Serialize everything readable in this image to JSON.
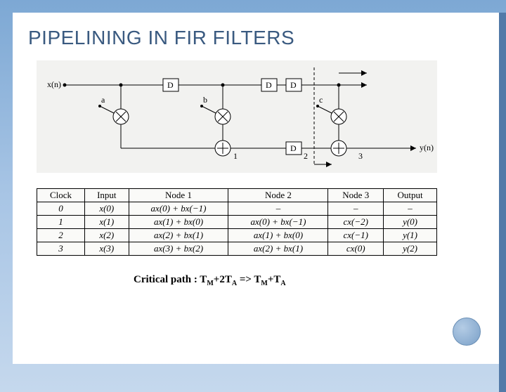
{
  "title": "PIPELINING IN FIR FILTERS",
  "diagram": {
    "input_label": "x(n)",
    "output_label": "y(n)",
    "delays": [
      "D",
      "D",
      "D",
      "D"
    ],
    "coeffs": [
      "a",
      "b",
      "c"
    ],
    "node_labels": [
      "1",
      "2",
      "3"
    ]
  },
  "table": {
    "headers": [
      "Clock",
      "Input",
      "Node 1",
      "Node 2",
      "Node 3",
      "Output"
    ],
    "rows": [
      [
        "0",
        "x(0)",
        "ax(0) + bx(−1)",
        "–",
        "–",
        "–"
      ],
      [
        "1",
        "x(1)",
        "ax(1) + bx(0)",
        "ax(0) + bx(−1)",
        "cx(−2)",
        "y(0)"
      ],
      [
        "2",
        "x(2)",
        "ax(2) + bx(1)",
        "ax(1) + bx(0)",
        "cx(−1)",
        "y(1)"
      ],
      [
        "3",
        "x(3)",
        "ax(3) + bx(2)",
        "ax(2) + bx(1)",
        "cx(0)",
        "y(2)"
      ]
    ]
  },
  "critical_path": {
    "prefix": "Critical path : T",
    "sub1": "M",
    "mid1": "+2T",
    "sub2": "A",
    "arrow": " => T",
    "sub3": "M",
    "mid2": "+T",
    "sub4": "A"
  },
  "chart_data": {
    "type": "table",
    "title": "Pipelined 3-tap FIR filter node contents by clock",
    "columns": [
      "Clock",
      "Input",
      "Node 1",
      "Node 2",
      "Node 3",
      "Output"
    ],
    "rows": [
      {
        "Clock": 0,
        "Input": "x(0)",
        "Node 1": "a·x(0)+b·x(-1)",
        "Node 2": "-",
        "Node 3": "-",
        "Output": "-"
      },
      {
        "Clock": 1,
        "Input": "x(1)",
        "Node 1": "a·x(1)+b·x(0)",
        "Node 2": "a·x(0)+b·x(-1)",
        "Node 3": "c·x(-2)",
        "Output": "y(0)"
      },
      {
        "Clock": 2,
        "Input": "x(2)",
        "Node 1": "a·x(2)+b·x(1)",
        "Node 2": "a·x(1)+b·x(0)",
        "Node 3": "c·x(-1)",
        "Output": "y(1)"
      },
      {
        "Clock": 3,
        "Input": "x(3)",
        "Node 1": "a·x(3)+b·x(2)",
        "Node 2": "a·x(2)+b·x(1)",
        "Node 3": "c·x(0)",
        "Output": "y(2)"
      }
    ],
    "critical_path_before": "T_M + 2·T_A",
    "critical_path_after": "T_M + T_A"
  }
}
